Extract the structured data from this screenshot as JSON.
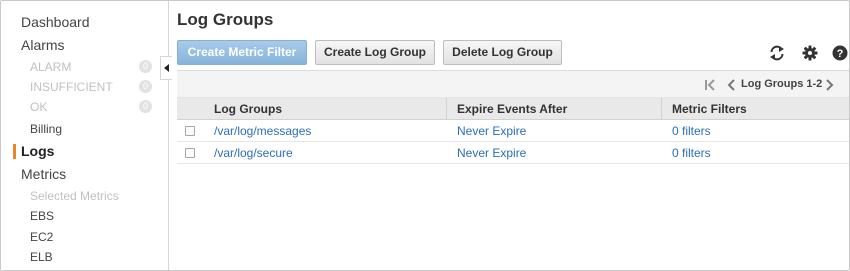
{
  "sidebar": {
    "items": [
      {
        "label": "Dashboard"
      },
      {
        "label": "Alarms"
      },
      {
        "label": "ALARM",
        "count": "0"
      },
      {
        "label": "INSUFFICIENT",
        "count": "0"
      },
      {
        "label": "OK",
        "count": "0"
      },
      {
        "label": "Billing"
      },
      {
        "label": "Logs"
      },
      {
        "label": "Metrics"
      },
      {
        "label": "Selected Metrics"
      },
      {
        "label": "EBS"
      },
      {
        "label": "EC2"
      },
      {
        "label": "ELB"
      }
    ],
    "active": "Logs"
  },
  "page": {
    "title": "Log Groups"
  },
  "toolbar": {
    "create_metric_filter": "Create Metric Filter",
    "create_log_group": "Create Log Group",
    "delete_log_group": "Delete Log Group",
    "icons": [
      "refresh-icon",
      "gear-icon",
      "help-icon"
    ]
  },
  "pager": {
    "label": "Log Groups 1-2"
  },
  "table": {
    "columns": [
      "Log Groups",
      "Expire Events After",
      "Metric Filters"
    ],
    "rows": [
      {
        "name": "/var/log/messages",
        "expire": "Never Expire",
        "filters": "0 filters"
      },
      {
        "name": "/var/log/secure",
        "expire": "Never Expire",
        "filters": "0 filters"
      }
    ]
  },
  "colors": {
    "accent": "#e8862a",
    "link": "#2a6ebb",
    "primary_button": "#86b3da"
  }
}
